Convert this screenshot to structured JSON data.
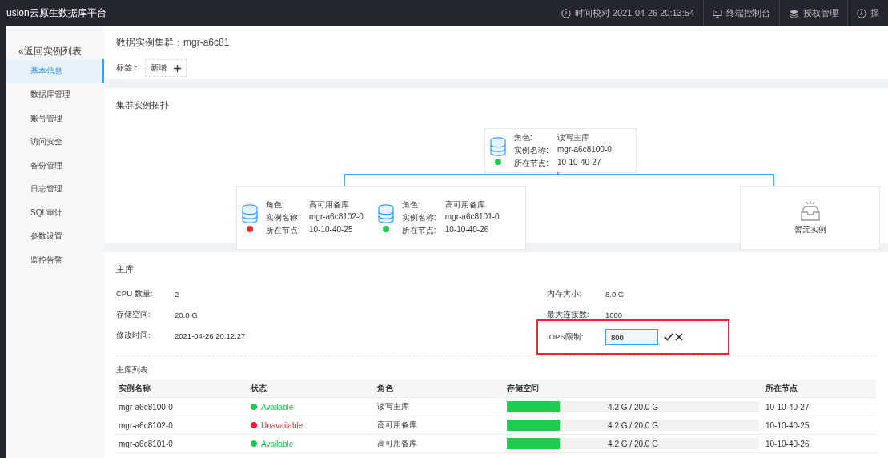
{
  "header": {
    "title": "usion云原生数据库平台",
    "items": [
      {
        "kind": "clock",
        "label": "时间校对 2021-04-26 20:13:54"
      },
      {
        "kind": "monitor",
        "label": "终端控制台"
      },
      {
        "kind": "layers",
        "label": "授权管理"
      },
      {
        "kind": "clock",
        "label": "操"
      }
    ]
  },
  "sidebar": {
    "back": "«返回实例列表",
    "items": [
      {
        "label": "基本信息",
        "selected": true
      },
      {
        "label": "数据库管理",
        "selected": false
      },
      {
        "label": "账号管理",
        "selected": false
      },
      {
        "label": "访问安全",
        "selected": false
      },
      {
        "label": "备份管理",
        "selected": false
      },
      {
        "label": "日志管理",
        "selected": false
      },
      {
        "label": "SQL审计",
        "selected": false
      },
      {
        "label": "参数设置",
        "selected": false
      },
      {
        "label": "监控告警",
        "selected": false
      }
    ]
  },
  "cluster": {
    "title": "数据实例集群：mgr-a6c81",
    "tags_label": "标签：",
    "add_tag": "新增"
  },
  "topology": {
    "title": "集群实例拓扑",
    "primary": {
      "role_label": "角色:",
      "role": "读写主库",
      "name_label": "实例名称:",
      "name": "mgr-a6c8100-0",
      "node_label": "所在节点:",
      "node": "10-10-40-27",
      "healthy": true
    },
    "replicas": [
      {
        "role_label": "角色:",
        "role": "高可用备库",
        "name_label": "实例名称:",
        "name": "mgr-a6c8102-0",
        "node_label": "所在节点:",
        "node": "10-10-40-25",
        "healthy": false
      },
      {
        "role_label": "角色:",
        "role": "高可用备库",
        "name_label": "实例名称:",
        "name": "mgr-a6c8101-0",
        "node_label": "所在节点:",
        "node": "10-10-40-26",
        "healthy": true
      }
    ],
    "empty": "暂无实例"
  },
  "primary_db": {
    "title": "主库",
    "fields": [
      {
        "label": "CPU 数量:",
        "value": "2",
        "kind": "text"
      },
      {
        "label": "内存大小:",
        "value": "8.0 G",
        "kind": "text"
      },
      {
        "label": "存储空间:",
        "value": "20.0 G",
        "kind": "text"
      },
      {
        "label": "最大连接数:",
        "value": "1000",
        "kind": "text"
      },
      {
        "label": "修改时间:",
        "value": "2021-04-26 20:12:27",
        "kind": "text"
      },
      {
        "label": "IOPS限制:",
        "value": "800",
        "kind": "input",
        "highlighted": true
      }
    ]
  },
  "table": {
    "title": "主库列表",
    "columns": [
      "实例名称",
      "状态",
      "角色",
      "存储空间",
      "所在节点"
    ],
    "rows": [
      {
        "name": "mgr-a6c8100-0",
        "status": "Available",
        "available": true,
        "role": "读写主库",
        "level": 0.21,
        "storage": "4.2 G / 20.0 G",
        "node": "10-10-40-27"
      },
      {
        "name": "mgr-a6c8102-0",
        "status": "Unavailable",
        "available": false,
        "role": "高可用备库",
        "level": 0.21,
        "storage": "4.2 G / 20.0 G",
        "node": "10-10-40-25"
      },
      {
        "name": "mgr-a6c8101-0",
        "status": "Available",
        "available": true,
        "role": "高可用备库",
        "level": 0.21,
        "storage": "4.2 G / 20.0 G",
        "node": "10-10-40-26"
      }
    ]
  }
}
